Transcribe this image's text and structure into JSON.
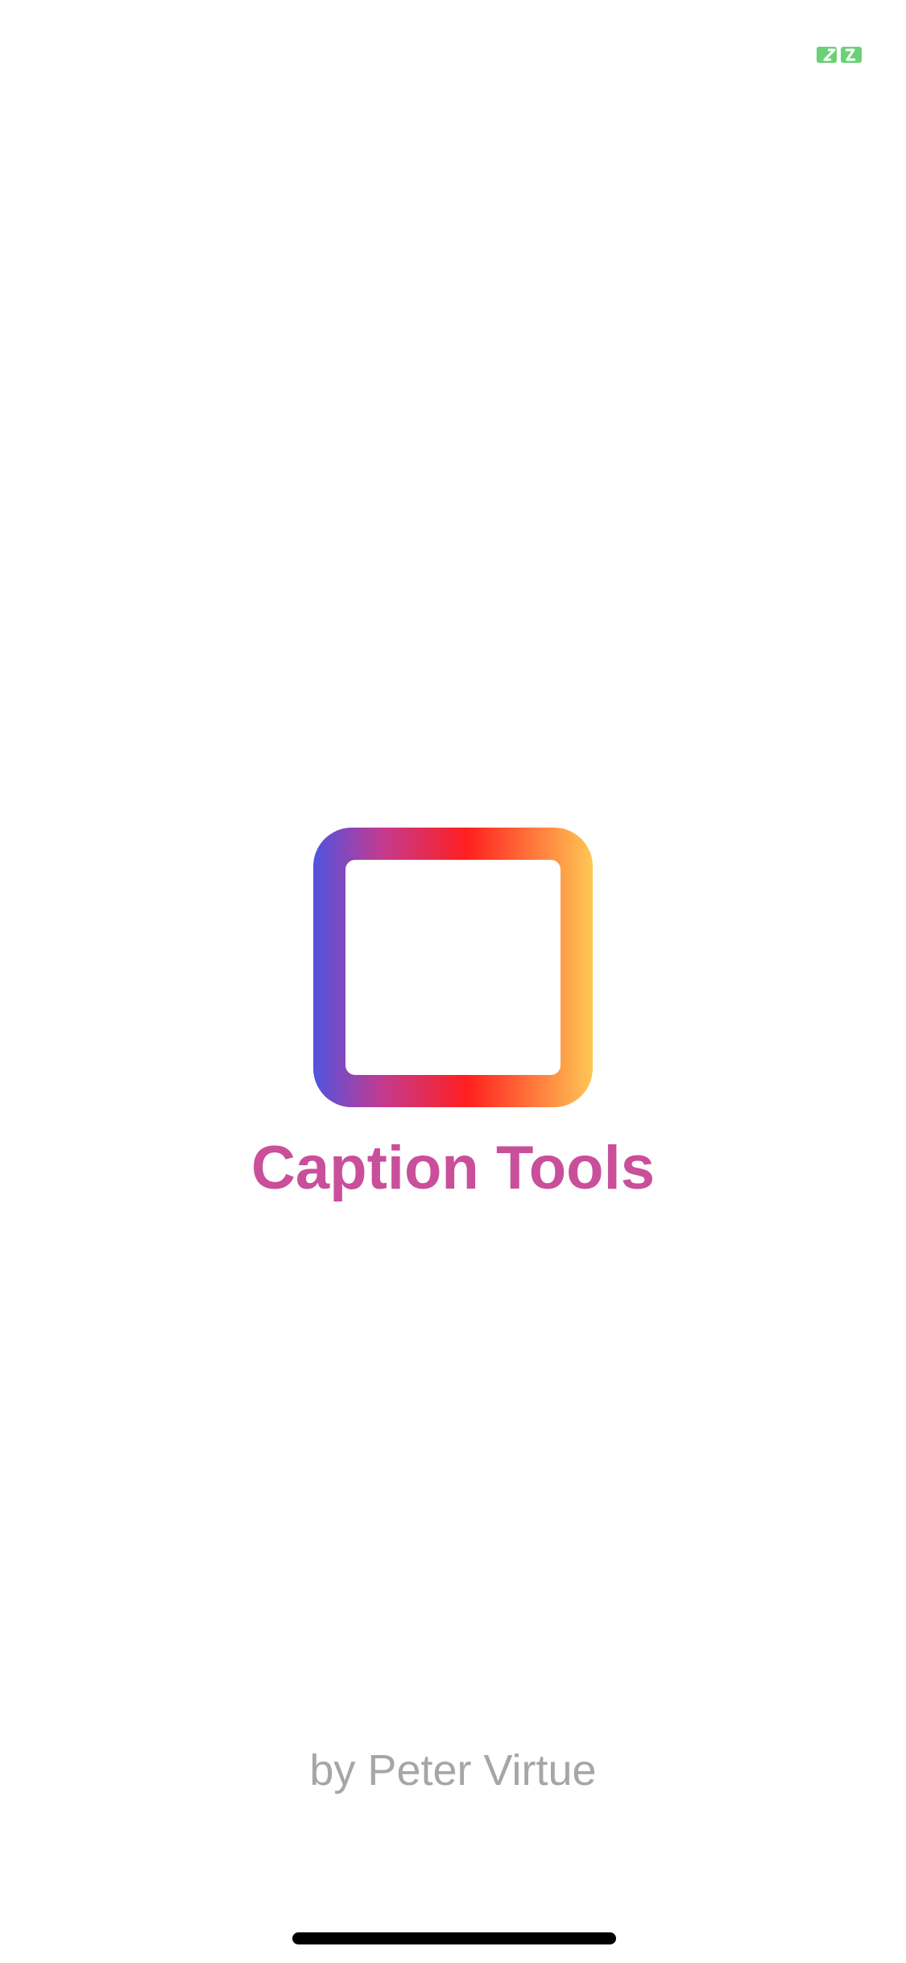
{
  "status_bar": {
    "indicator_icon": "screen-mirroring-icon",
    "indicator_color": "#6cd176"
  },
  "splash": {
    "logo_icon": "hashtag-frame-icon",
    "logo_gradient": [
      "#4f53df",
      "#c53a8f",
      "#ff1f1f",
      "#ffc755"
    ],
    "title": "Caption Tools",
    "title_color": "#c94f9b",
    "author": "by Peter Virtue",
    "author_color": "#a6a6a6"
  },
  "home_indicator": {
    "color": "#000000"
  }
}
